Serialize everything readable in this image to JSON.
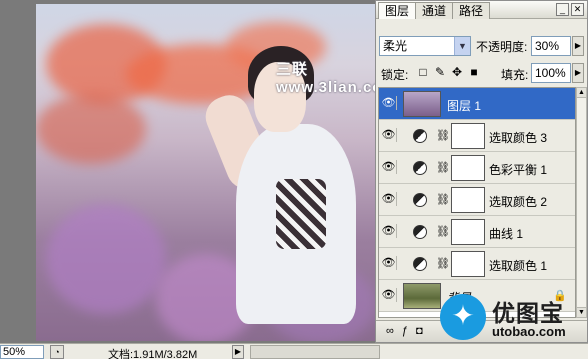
{
  "document": {
    "watermark": "三联 www.3lian.com"
  },
  "layers_panel": {
    "tabs": [
      "图层",
      "通道",
      "路径"
    ],
    "active_tab": "图层",
    "blend_mode": "柔光",
    "opacity_label": "不透明度:",
    "opacity_value": "30%",
    "lock_label": "锁定:",
    "fill_label": "填充:",
    "fill_value": "100%",
    "layers": [
      {
        "name": "图层 1",
        "type": "pixel",
        "selected": true,
        "visible": true
      },
      {
        "name": "选取颜色 3",
        "type": "adjustment",
        "selected": false,
        "visible": true
      },
      {
        "name": "色彩平衡 1",
        "type": "adjustment",
        "selected": false,
        "visible": true
      },
      {
        "name": "选取颜色 2",
        "type": "adjustment",
        "selected": false,
        "visible": true
      },
      {
        "name": "曲线 1",
        "type": "adjustment",
        "selected": false,
        "visible": true
      },
      {
        "name": "选取颜色 1",
        "type": "adjustment",
        "selected": false,
        "visible": true
      },
      {
        "name": "背景",
        "type": "background",
        "selected": false,
        "visible": true,
        "locked": true
      }
    ]
  },
  "logo": {
    "name": "优图宝",
    "url": "utobao.com"
  },
  "status_bar": {
    "zoom": "50%",
    "doc_info": "文档:1.91M/3.82M"
  },
  "colors": {
    "selection": "#3169c6",
    "logo_blue": "#1a9be0"
  }
}
